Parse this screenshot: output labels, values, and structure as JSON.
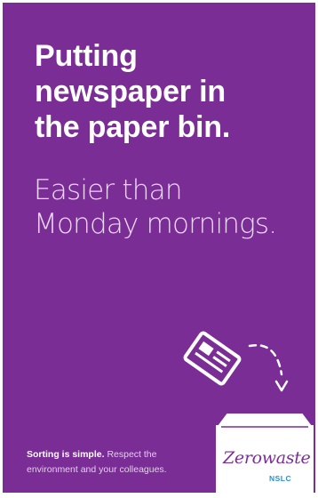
{
  "headline": {
    "line1": "Putting",
    "line2": "newspaper in",
    "line3": "the paper bin."
  },
  "subheadline": {
    "line1": "Easier than",
    "line2": "Monday mornings."
  },
  "tagline": {
    "bold": "Sorting is simple.",
    "rest_line1": " Respect the",
    "rest_line2": "environment and your colleagues."
  },
  "logo": {
    "wordmark": "Zerowaste",
    "subtext": "NSLC"
  },
  "icons": {
    "newspaper": "newspaper-icon",
    "arrow": "curved-arrow-icon",
    "bin": "recycling-bin-icon"
  },
  "colors": {
    "background": "#7b2d96",
    "text": "#ffffff",
    "logo_accent": "#2a8fd0"
  }
}
